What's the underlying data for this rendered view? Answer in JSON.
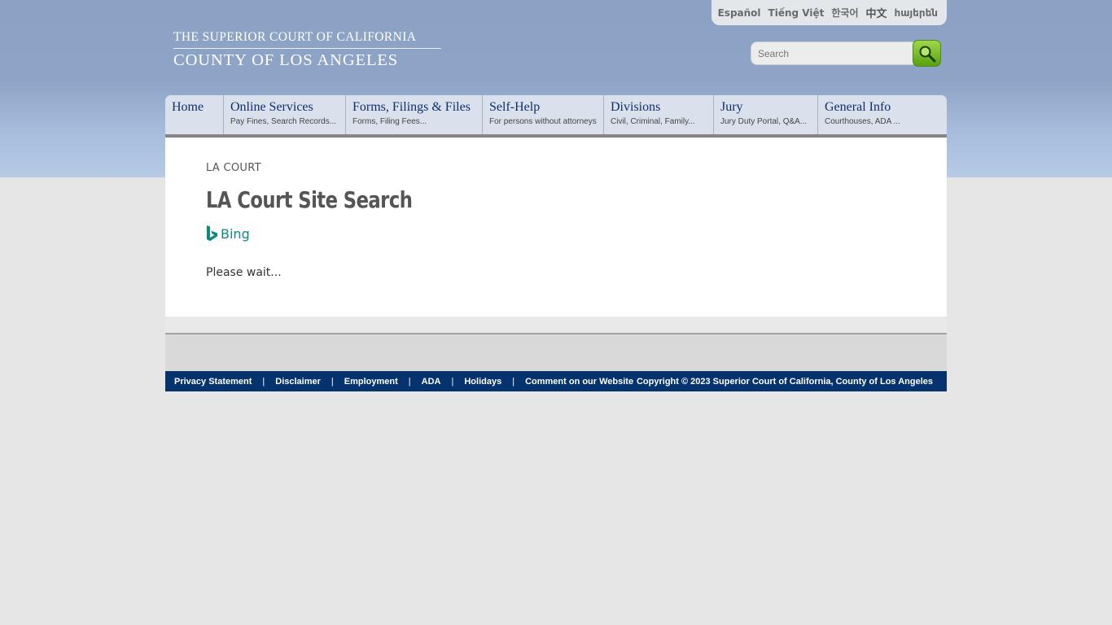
{
  "languages": [
    "Español",
    "Tiếng Việt",
    "한국어",
    "中文",
    "հայերեն"
  ],
  "logo": {
    "line1": "THE SUPERIOR COURT OF CALIFORNIA",
    "line2": "COUNTY OF LOS ANGELES"
  },
  "search": {
    "placeholder": "Search",
    "button_icon": "magnifier-icon"
  },
  "nav": [
    {
      "title": "Home",
      "sub": ""
    },
    {
      "title": "Online Services",
      "sub": "Pay Fines, Search Records..."
    },
    {
      "title": "Forms, Filings & Files",
      "sub": "Forms, Filing Fees..."
    },
    {
      "title": "Self-Help",
      "sub": "For persons without attorneys"
    },
    {
      "title": "Divisions",
      "sub": "Civil, Criminal, Family..."
    },
    {
      "title": "Jury",
      "sub": "Jury Duty Portal, Q&A..."
    },
    {
      "title": "General Info",
      "sub": "Courthouses, ADA ..."
    }
  ],
  "breadcrumb": "LA COURT",
  "page_title": "LA Court Site Search",
  "bing_label": "Bing",
  "status_text": "Please wait...",
  "footer": {
    "links": [
      "Privacy Statement",
      "Disclaimer",
      "Employment",
      "ADA",
      "Holidays",
      "Comment on our Website"
    ],
    "separator": "|",
    "copyright": "Copyright © 2023 Superior Court of California, County of Los Angeles"
  },
  "colors": {
    "header_blue": "#8ea4c6",
    "nav_text": "#0e2f6a",
    "footer_bg": "#05336d",
    "bing_teal": "#0e8a7d",
    "search_green": "#6fb820"
  }
}
